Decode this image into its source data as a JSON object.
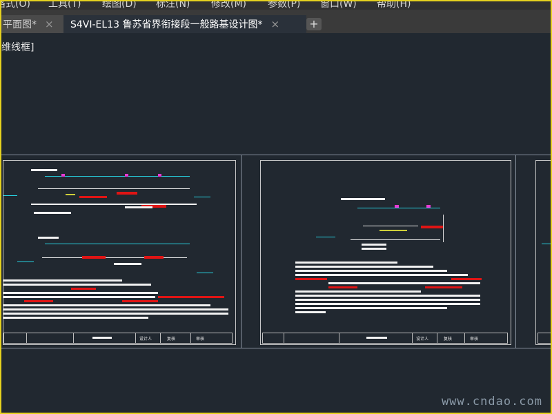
{
  "menubar": {
    "items": [
      {
        "label": "格式(O)"
      },
      {
        "label": "工具(T)"
      },
      {
        "label": "绘图(D)"
      },
      {
        "label": "标注(N)"
      },
      {
        "label": "修改(M)"
      },
      {
        "label": "参数(P)"
      },
      {
        "label": "窗口(W)"
      },
      {
        "label": "帮助(H)"
      }
    ]
  },
  "tabs": [
    {
      "label": "平面图*",
      "close": "×"
    },
    {
      "label": "S4VI-EL13 鲁苏省界衔接段一般路基设计图*",
      "close": "×"
    }
  ],
  "new_tab": {
    "label": "+"
  },
  "viewport": {
    "label": "维线框]"
  },
  "sheets": {
    "titleblock_fields": [
      "设计人",
      "复核",
      "审核"
    ]
  },
  "watermark": {
    "text": "www.cndao.com"
  },
  "colors": {
    "frame": "#e6d21e",
    "canvas": "#212830",
    "accent_red": "#e01414",
    "accent_cyan": "#27d7e6",
    "accent_magenta": "#e83ad6"
  }
}
